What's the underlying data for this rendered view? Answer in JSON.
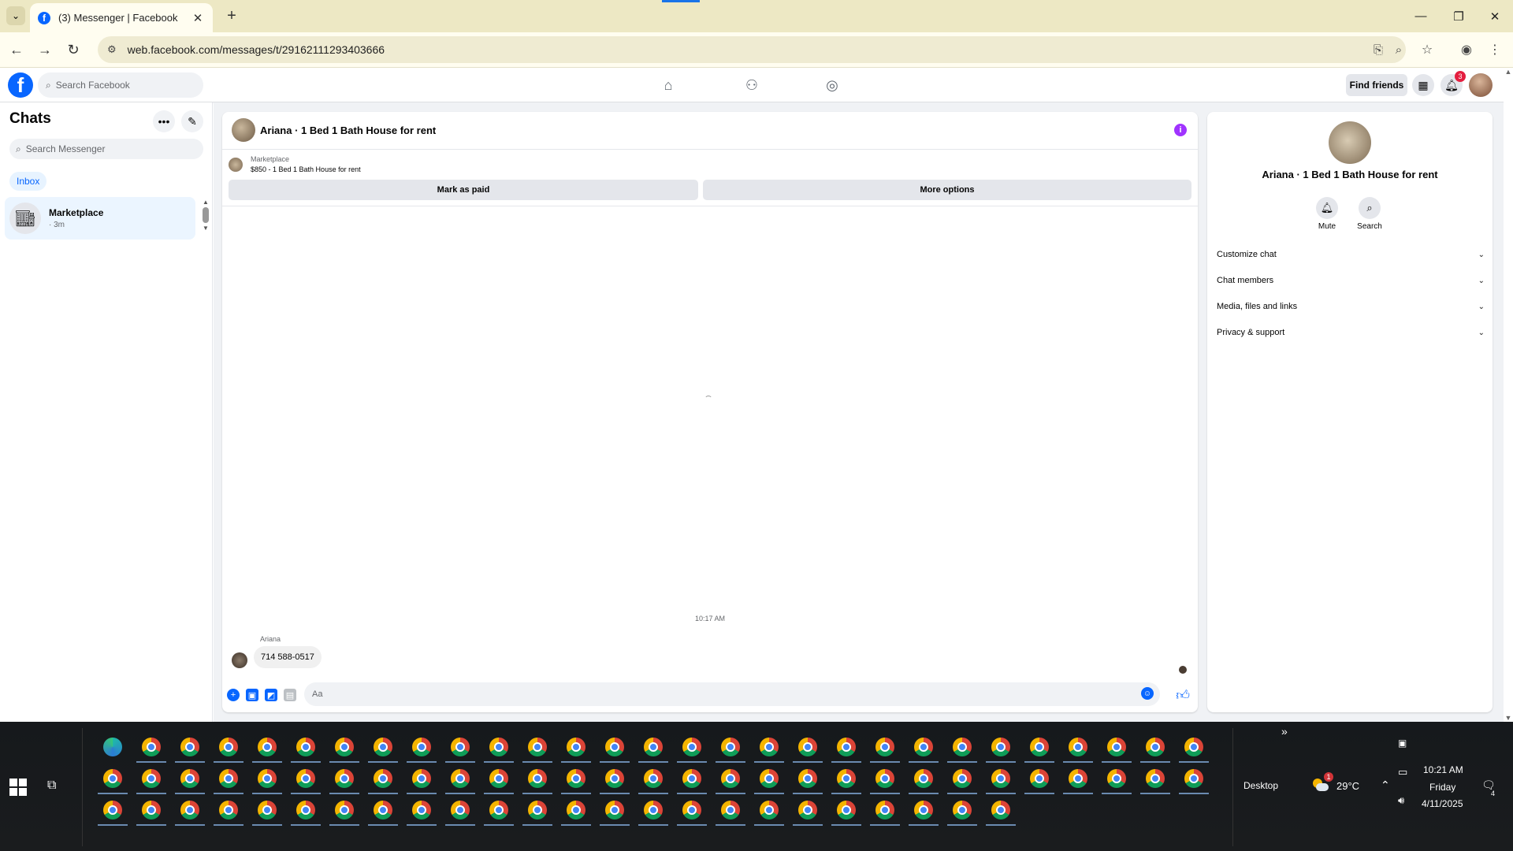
{
  "browser": {
    "tab_title": "(3) Messenger | Facebook",
    "new_tab": "+",
    "url": "web.facebook.com/messages/t/29162111293403666"
  },
  "fb": {
    "search_placeholder": "Search Facebook",
    "find_friends": "Find friends",
    "notification_count": "3"
  },
  "sidebar": {
    "title": "Chats",
    "search_placeholder": "Search Messenger",
    "inbox_label": "Inbox",
    "chats": [
      {
        "name": "Marketplace",
        "time": "· 3m"
      }
    ]
  },
  "conversation": {
    "title": "Ariana · 1 Bed 1 Bath House for rent",
    "marketplace_label": "Marketplace",
    "listing": "$850 - 1 Bed 1 Bath House for rent",
    "mark_paid": "Mark as paid",
    "more_options": "More options",
    "timestamp": "10:17 AM",
    "sender": "Ariana",
    "message": "714 588-0517",
    "composer_placeholder": "Aa"
  },
  "info_panel": {
    "name": "Ariana · 1 Bed 1 Bath House for rent",
    "mute": "Mute",
    "search": "Search",
    "sections": [
      "Customize chat",
      "Chat members",
      "Media, files and links",
      "Privacy & support"
    ]
  },
  "taskbar": {
    "desktop": "Desktop",
    "temperature": "29°C",
    "weather_badge": "1",
    "time": "10:21 AM",
    "day": "Friday",
    "date": "4/11/2025",
    "notif_count": "4"
  },
  "colors": {
    "fb_blue": "#0866ff",
    "info_purple": "#a033ff",
    "tabstrip": "#ede8c4"
  },
  "icons": [
    "facebook-logo",
    "search-icon",
    "home-icon",
    "friends-icon",
    "groups-icon",
    "menu-grid-icon",
    "bell-icon",
    "more-icon",
    "compose-icon",
    "store-icon",
    "info-icon",
    "mute-bell-icon",
    "chevron-down-icon",
    "plus-icon",
    "image-icon",
    "sticker-icon",
    "gif-icon",
    "emoji-icon",
    "like-icon",
    "chrome-icon",
    "edge-icon"
  ]
}
